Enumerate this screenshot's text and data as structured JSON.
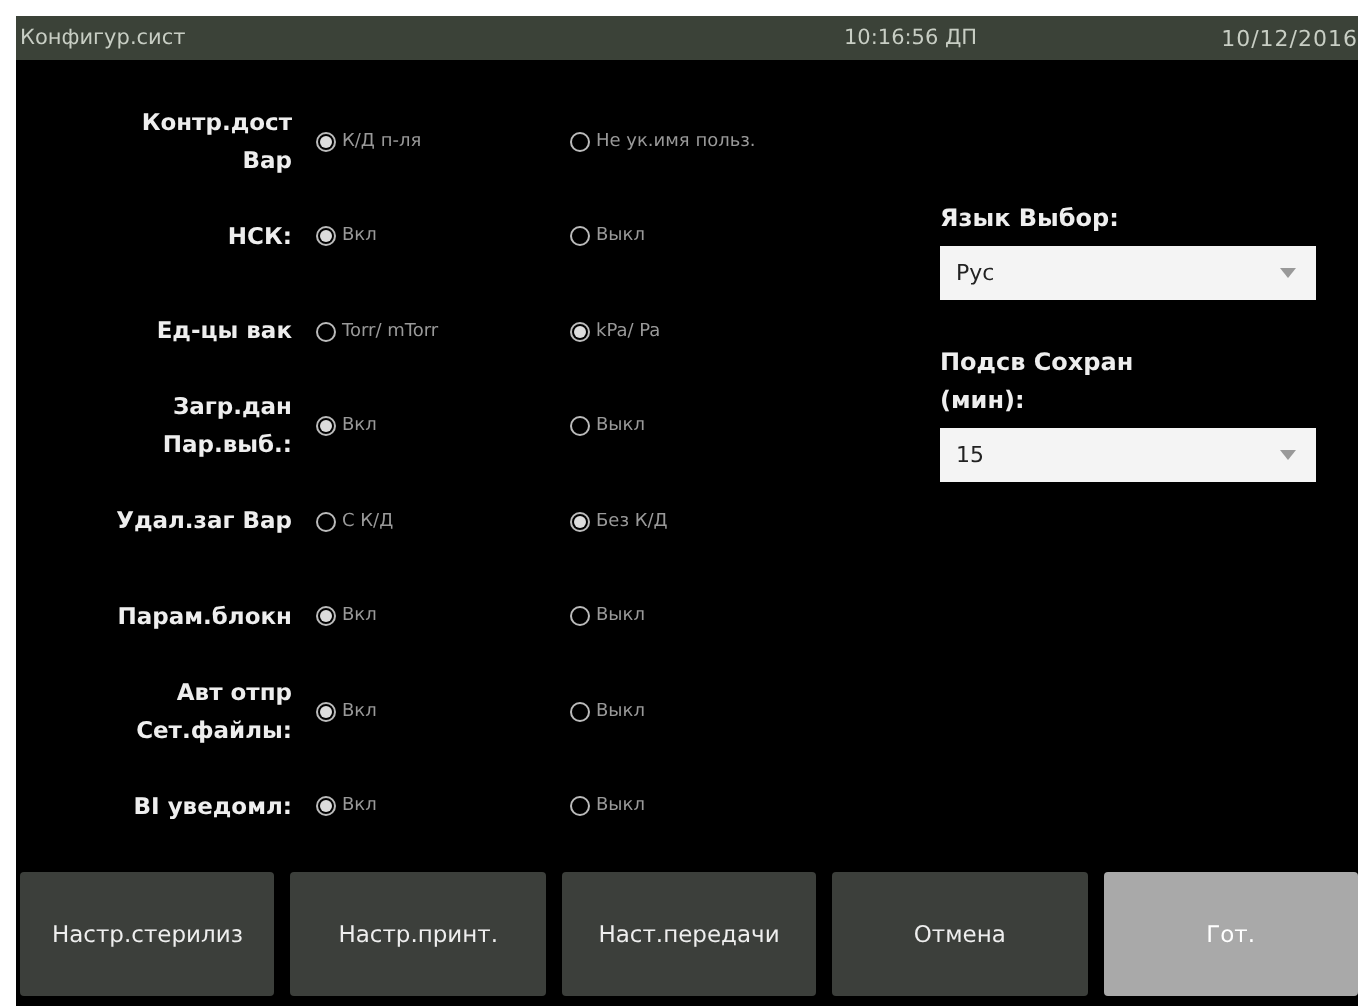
{
  "header": {
    "title": "Конфигур.сист",
    "time": "10:16:56 ДП",
    "date": "10/12/2016"
  },
  "settings": [
    {
      "label": "Контр.дост Вар",
      "options": [
        {
          "label": "К/Д п-ля",
          "selected": true
        },
        {
          "label": "Не ук.имя польз.",
          "selected": false
        }
      ]
    },
    {
      "label": "НСК:",
      "options": [
        {
          "label": "Вкл",
          "selected": true
        },
        {
          "label": "Выкл",
          "selected": false
        }
      ]
    },
    {
      "label": "Ед-цы вак",
      "options": [
        {
          "label": "Torr/ mTorr",
          "selected": false
        },
        {
          "label": "kPa/ Pa",
          "selected": true
        }
      ]
    },
    {
      "label": "Загр.дан Пар.выб.:",
      "options": [
        {
          "label": "Вкл",
          "selected": true
        },
        {
          "label": "Выкл",
          "selected": false
        }
      ]
    },
    {
      "label": "Удал.заг Вар",
      "options": [
        {
          "label": "С К/Д",
          "selected": false
        },
        {
          "label": "Без К/Д",
          "selected": true
        }
      ]
    },
    {
      "label": "Парам.блокн",
      "options": [
        {
          "label": "Вкл",
          "selected": true
        },
        {
          "label": "Выкл",
          "selected": false
        }
      ]
    },
    {
      "label": "Авт отпр Сет.файлы:",
      "options": [
        {
          "label": "Вкл",
          "selected": true
        },
        {
          "label": "Выкл",
          "selected": false
        }
      ]
    },
    {
      "label": "BI уведомл:",
      "options": [
        {
          "label": "Вкл",
          "selected": true
        },
        {
          "label": "Выкл",
          "selected": false
        }
      ]
    }
  ],
  "dropdowns": [
    {
      "label": "Язык Выбор:",
      "value": "Рус"
    },
    {
      "label": "Подсв Сохран (мин):",
      "value": "15"
    }
  ],
  "buttons": [
    {
      "label": "Настр.стерилиз",
      "disabled": false
    },
    {
      "label": "Настр.принт.",
      "disabled": false
    },
    {
      "label": "Наст.передачи",
      "disabled": false
    },
    {
      "label": "Отмена",
      "disabled": false
    },
    {
      "label": "Гот.",
      "disabled": true
    }
  ]
}
